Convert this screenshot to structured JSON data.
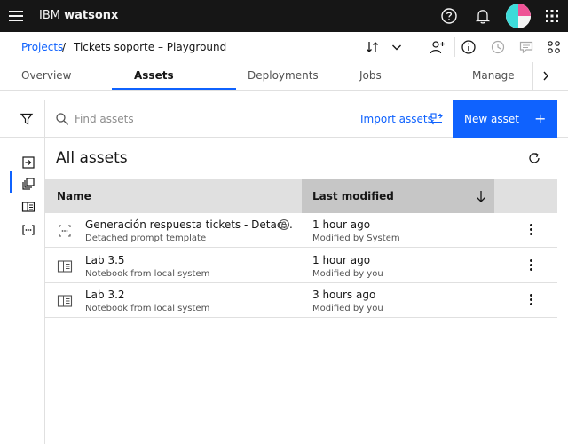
{
  "topbar": {
    "brand_prefix": "IBM",
    "brand_product": "watsonx",
    "icons": [
      "hamburger-menu-icon",
      "help-icon",
      "notification-bell-icon",
      "user-avatar",
      "app-switcher-icon"
    ]
  },
  "breadcrumb": {
    "parent": "Projects",
    "separator": "/",
    "current": "Tickets soporte – Playground",
    "icons": [
      "import-export-icon",
      "chevron-down-icon",
      "add-collaborator-icon",
      "info-icon",
      "history-icon",
      "comments-icon",
      "integrations-icon"
    ]
  },
  "tabs": [
    {
      "label": "Overview",
      "active": false
    },
    {
      "label": "Assets",
      "active": true
    },
    {
      "label": "Deployments",
      "active": false
    },
    {
      "label": "Jobs",
      "active": false
    },
    {
      "label": "Manage",
      "active": false
    }
  ],
  "toolbar": {
    "search_placeholder": "Find assets",
    "import_label": "Import assets",
    "new_label": "New asset",
    "new_plus": "+"
  },
  "main": {
    "title": "All assets"
  },
  "table": {
    "columns": [
      "Name",
      "Last modified"
    ],
    "rows": [
      {
        "name": "Generación respuesta tickets - Detac...",
        "type": "Detached prompt template",
        "modified": "1 hour ago",
        "by": "Modified by System",
        "icon": "detached-prompt-icon"
      },
      {
        "name": "Lab 3.5",
        "type": "Notebook from local system",
        "modified": "1 hour ago",
        "by": "Modified by you",
        "icon": "notebook-icon"
      },
      {
        "name": "Lab 3.2",
        "type": "Notebook from local system",
        "modified": "3 hours ago",
        "by": "Modified by you",
        "icon": "notebook-icon"
      }
    ]
  },
  "colors": {
    "primary": "#0f62fe",
    "topbar_bg": "#161616",
    "header_bg": "#e0e0e0",
    "sorted_header_bg": "#c6c6c6",
    "avatar_teal": "#3ddbd9",
    "avatar_pink": "#ee5396"
  }
}
